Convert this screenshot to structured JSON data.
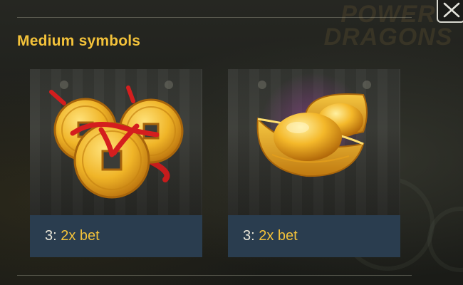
{
  "panel": {
    "title": "Medium symbols",
    "close_icon": "close-icon"
  },
  "background": {
    "logo_text_line1": "POWER",
    "logo_text_line2": "DRAGONS"
  },
  "symbols": [
    {
      "name": "lucky-coins",
      "icon": "chinese-coins-icon",
      "count": "3:",
      "multiplier": "2x bet"
    },
    {
      "name": "gold-ingots",
      "icon": "gold-ingot-icon",
      "count": "3:",
      "multiplier": "2x bet"
    }
  ],
  "colors": {
    "title": "#f3c23a",
    "multiplier": "#f3c23a",
    "payout_band": "#2a3d4f",
    "close_border": "#d9d9d0"
  }
}
